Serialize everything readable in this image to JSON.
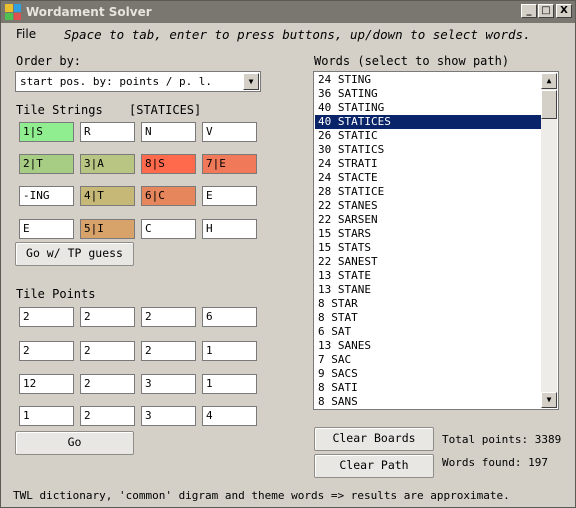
{
  "window": {
    "title": "Wordament Solver",
    "controls": {
      "minimize": "_",
      "maximize": "□",
      "close": "X"
    }
  },
  "menu": {
    "file": "File"
  },
  "hint": "Space to tab, enter to press buttons, up/down to select words.",
  "order": {
    "label": "Order by:",
    "selected": "start pos. by: points / p. l."
  },
  "tile_strings": {
    "label": "Tile Strings",
    "current_word": "[STATICES]",
    "rows": [
      [
        {
          "text": "1|S",
          "color": "#90ee90"
        },
        {
          "text": "R",
          "color": "#ffffff"
        },
        {
          "text": "N",
          "color": "#ffffff"
        },
        {
          "text": "V",
          "color": "#ffffff"
        }
      ],
      [
        {
          "text": "2|T",
          "color": "#a7cd85"
        },
        {
          "text": "3|A",
          "color": "#b9c583"
        },
        {
          "text": "8|S",
          "color": "#ff6a4d"
        },
        {
          "text": "7|E",
          "color": "#ef7958"
        }
      ],
      [
        {
          "text": "-ING",
          "color": "#ffffff"
        },
        {
          "text": "4|T",
          "color": "#c6b978"
        },
        {
          "text": "6|C",
          "color": "#e6865c"
        },
        {
          "text": "E",
          "color": "#ffffff"
        }
      ],
      [
        {
          "text": "E",
          "color": "#ffffff"
        },
        {
          "text": "5|I",
          "color": "#d8a36b"
        },
        {
          "text": "C",
          "color": "#ffffff"
        },
        {
          "text": "H",
          "color": "#ffffff"
        }
      ]
    ]
  },
  "go_tp_button": "Go w/ TP guess",
  "tile_points": {
    "label": "Tile Points",
    "rows": [
      [
        "2",
        "2",
        "2",
        "6"
      ],
      [
        "2",
        "2",
        "2",
        "1"
      ],
      [
        "12",
        "2",
        "3",
        "1"
      ],
      [
        "1",
        "2",
        "3",
        "4"
      ]
    ]
  },
  "go_button": "Go",
  "words": {
    "label": "Words (select to show path)",
    "selected_index": 3,
    "items": [
      "24 STING",
      "36 SATING",
      "40 STATING",
      "40 STATICES",
      "26 STATIC",
      "30 STATICS",
      "24 STRATI",
      "24 STACTE",
      "28 STATICE",
      "22 STANES",
      "22 SARSEN",
      "15 STARS",
      "15 STATS",
      "22 SANEST",
      "13 STATE",
      "13 STANE",
      "8 STAR",
      "8 STAT",
      "6 SAT",
      "13 SANES",
      "7 SAC",
      "9 SACS",
      "8 SATI",
      "8 SANS"
    ]
  },
  "clear_boards_button": "Clear Boards",
  "clear_path_button": "Clear Path",
  "stats": {
    "total_points_label": "Total points:",
    "total_points": "3389",
    "words_found_label": "Words found:",
    "words_found": "197"
  },
  "footer": "TWL dictionary, 'common' digram and theme words => results are approximate."
}
